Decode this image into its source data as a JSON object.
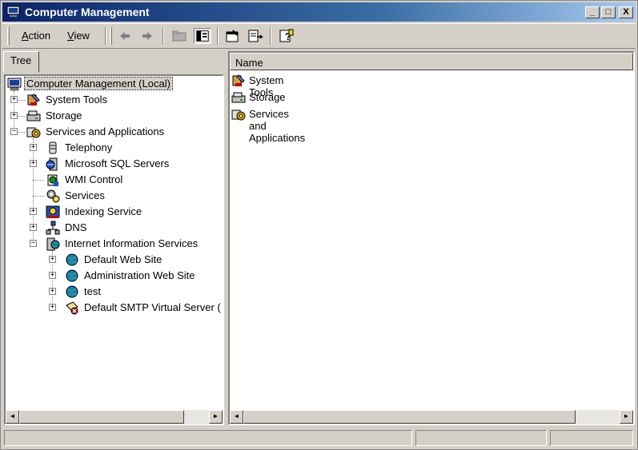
{
  "window": {
    "title": "Computer Management",
    "controls": {
      "minimize": "_",
      "maximize": "□",
      "close": "X"
    }
  },
  "menu": {
    "action": {
      "prefix": "",
      "accel": "A",
      "rest": "ction"
    },
    "view": {
      "prefix": "",
      "accel": "V",
      "rest": "iew"
    }
  },
  "toolbar": {
    "tools": [
      "back-icon",
      "forward-icon",
      "up-folder-icon",
      "show-hide-tree-icon",
      "properties-icon",
      "export-list-icon",
      "help-icon"
    ]
  },
  "tree": {
    "tab_label": "Tree",
    "items": [
      {
        "label": "Computer Management (Local)",
        "icon": "computer-icon"
      },
      {
        "label": "System Tools",
        "icon": "system-tools-icon"
      },
      {
        "label": "Storage",
        "icon": "storage-icon"
      },
      {
        "label": "Services and Applications",
        "icon": "services-apps-icon"
      },
      {
        "label": "Telephony",
        "icon": "telephony-icon"
      },
      {
        "label": "Microsoft SQL Servers",
        "icon": "sql-server-icon"
      },
      {
        "label": "WMI Control",
        "icon": "wmi-icon"
      },
      {
        "label": "Services",
        "icon": "services-icon"
      },
      {
        "label": "Indexing Service",
        "icon": "indexing-icon"
      },
      {
        "label": "DNS",
        "icon": "dns-icon"
      },
      {
        "label": "Internet Information Services",
        "icon": "iis-icon"
      },
      {
        "label": "Default Web Site",
        "icon": "globe-icon"
      },
      {
        "label": "Administration Web Site",
        "icon": "globe-icon"
      },
      {
        "label": "test",
        "icon": "globe-icon"
      },
      {
        "label": "Default SMTP Virtual Server (",
        "icon": "smtp-icon"
      }
    ]
  },
  "list": {
    "column_name": "Name",
    "items": [
      {
        "label": "System Tools",
        "icon": "system-tools-icon"
      },
      {
        "label": "Storage",
        "icon": "storage-icon"
      },
      {
        "label": "Services and Applications",
        "icon": "services-apps-icon"
      }
    ]
  },
  "scroll": {
    "left": "◄",
    "right": "►"
  },
  "colors": {
    "title_start": "#0a246a",
    "title_end": "#a6caf0",
    "face": "#d4d0c8"
  }
}
